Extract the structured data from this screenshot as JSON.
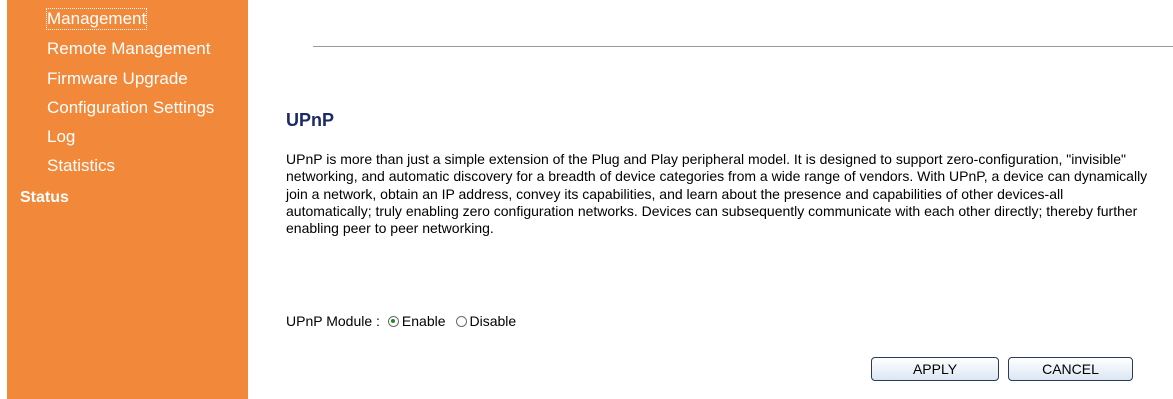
{
  "sidebar": {
    "items": [
      {
        "label": "Management",
        "active": true
      },
      {
        "label": "Remote Management"
      },
      {
        "label": "Firmware Upgrade"
      },
      {
        "label": "Configuration Settings"
      },
      {
        "label": "Log"
      },
      {
        "label": "Statistics"
      }
    ],
    "status_label": "Status"
  },
  "main": {
    "title": "UPnP",
    "description": "UPnP is more than just a simple extension of the Plug and Play peripheral model. It is designed to support zero-configuration, \"invisible\" networking, and automatic discovery for a breadth of device categories from a wide range of vendors. With UPnP, a device can dynamically join a network, obtain an IP address, convey its capabilities, and learn about the presence and capabilities of other devices-all automatically; truly enabling zero configuration networks. Devices can subsequently communicate with each other directly; thereby further enabling peer to peer networking.",
    "module_label": "UPnP Module :",
    "options": [
      {
        "label": "Enable",
        "checked": true
      },
      {
        "label": "Disable",
        "checked": false
      }
    ],
    "apply_label": "APPLY",
    "cancel_label": "CANCEL"
  },
  "colors": {
    "sidebar_bg": "#f1883a",
    "title": "#1b2a66",
    "radio_selected": "#1d8a1d"
  }
}
